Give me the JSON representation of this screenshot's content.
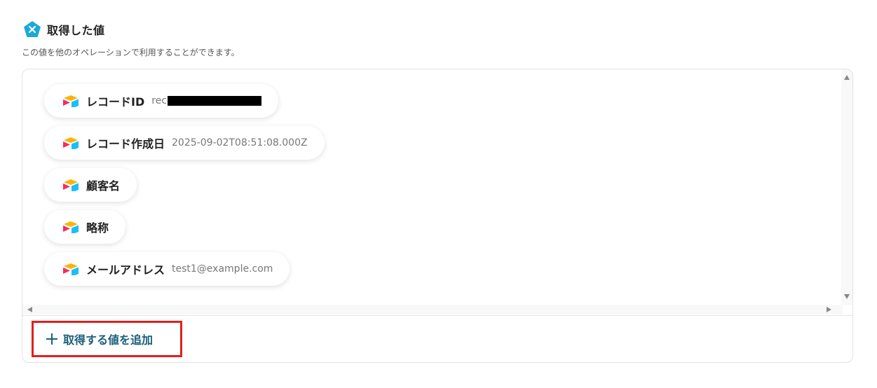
{
  "header": {
    "title": "取得した値",
    "subtitle": "この値を他のオペレーションで利用することができます。",
    "brand_color": "#1aa9d9"
  },
  "fields": [
    {
      "label": "レコードID",
      "value": "rec",
      "redacted": true
    },
    {
      "label": "レコード作成日",
      "value": "2025-09-02T08:51:08.000Z"
    },
    {
      "label": "顧客名",
      "value": ""
    },
    {
      "label": "略称",
      "value": ""
    },
    {
      "label": "メールアドレス",
      "value": "test1@example.com"
    }
  ],
  "add_button": {
    "label": "取得する値を追加",
    "text_color": "#1a5f7a",
    "highlight_color": "#e0201c"
  },
  "icons": {
    "header_logo": "x-pentagon-logo-icon",
    "field_icon": "airtable-icon",
    "add_icon": "plus-icon"
  }
}
